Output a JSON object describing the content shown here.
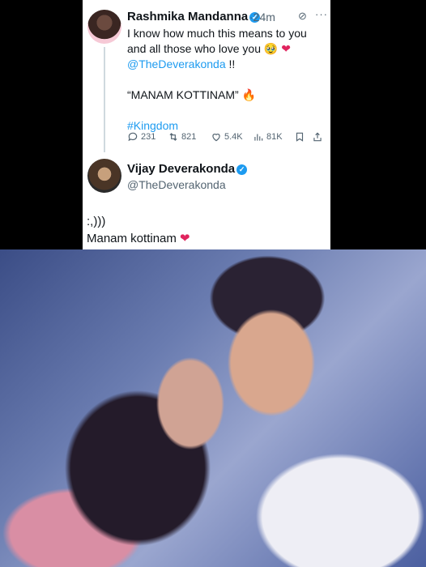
{
  "tweet": {
    "author": "Rashmika Mandanna",
    "time": "24m",
    "line1": "I know how much this means to you",
    "line2": "and all those who love you 🥹",
    "mention": "@TheDeverakonda",
    "excl": " !!",
    "quote": "“MANAM KOTTINAM” 🔥",
    "hashtag": "#Kingdom",
    "stats": {
      "replies": "231",
      "retweets": "821",
      "likes": "5.4K",
      "views": "81K"
    }
  },
  "reply": {
    "author": "Vijay Deverakonda",
    "handle": "@TheDeverakonda"
  },
  "caption": {
    "line1": ":,)))",
    "line2": "Manam kottinam"
  },
  "colors": {
    "accent": "#1d9bf0",
    "heart": "#e0245e",
    "muted": "#536471"
  }
}
